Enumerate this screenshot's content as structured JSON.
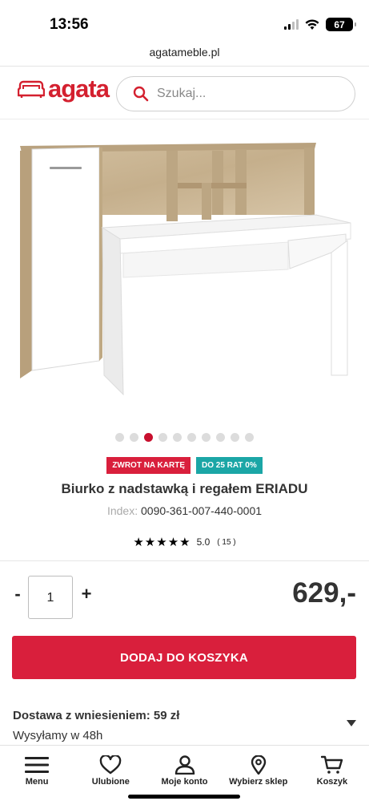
{
  "status_bar": {
    "time": "13:56",
    "battery": "67"
  },
  "browser": {
    "url": "agatameble.pl"
  },
  "header": {
    "logo_text": "agata",
    "search_placeholder": "Szukaj..."
  },
  "carousel": {
    "total": 10,
    "active_index": 2
  },
  "badges": {
    "promo_card": "ZWROT NA KARTĘ",
    "installments": "DO 25 RAT 0%"
  },
  "product": {
    "title": "Biurko z nadstawką i regałem ERIADU",
    "index_label": "Index:",
    "index_value": "0090-361-007-440-0001",
    "rating_stars": 5,
    "rating_value": "5.0",
    "rating_count": "( 15 )",
    "price": "629,-"
  },
  "quantity": {
    "minus": "-",
    "value": "1",
    "plus": "+"
  },
  "cart": {
    "add_label": "DODAJ DO KOSZYKA"
  },
  "delivery": {
    "title": "Dostawa z wniesieniem: 59 zł",
    "subtitle": "Wysyłamy w 48h"
  },
  "bottom_nav": {
    "menu": "Menu",
    "favorites": "Ulubione",
    "account": "Moje konto",
    "store": "Wybierz sklep",
    "cart": "Koszyk"
  },
  "colors": {
    "brand_red": "#d91f3c",
    "teal": "#1ba6a6",
    "oak": "#c9b493"
  },
  "icons": [
    "signal-icon",
    "wifi-icon",
    "battery-icon",
    "logo-sofa-icon",
    "search-icon",
    "chevron-down-icon",
    "menu-icon",
    "heart-icon",
    "user-icon",
    "location-pin-icon",
    "cart-icon"
  ]
}
